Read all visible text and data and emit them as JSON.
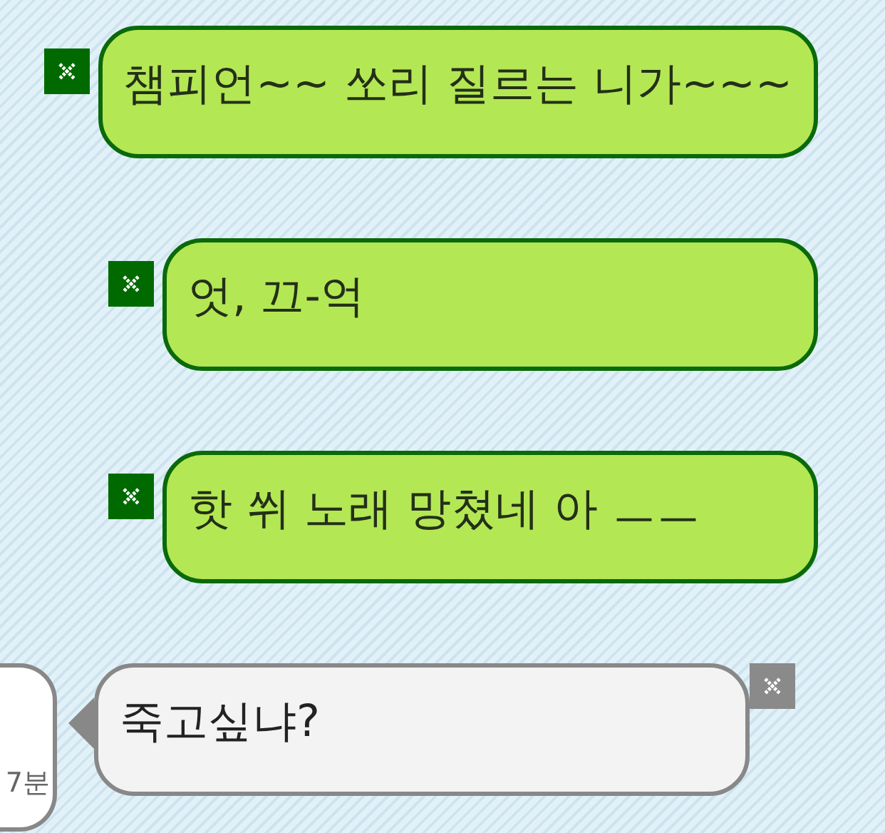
{
  "messages": [
    {
      "kind": "sent",
      "text": "챔피언~~ 쏘리 질르는 니가~~~"
    },
    {
      "kind": "sent",
      "text": "엇, 끄-억"
    },
    {
      "kind": "sent",
      "text": "핫 쒸 노래 망쳤네 아 ㅡㅡ"
    },
    {
      "kind": "received",
      "text": "죽고싶냐?"
    }
  ],
  "side_card": {
    "time": "7분"
  }
}
